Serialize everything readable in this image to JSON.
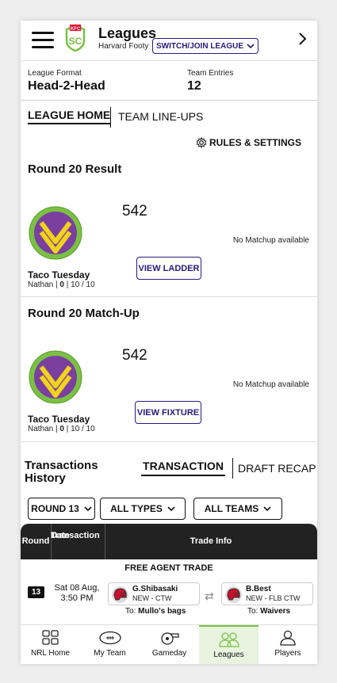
{
  "header": {
    "title": "Leagues",
    "subtitle": "Harvard Footy",
    "switch_label": "SWITCH/JOIN LEAGUE"
  },
  "info": {
    "format_label": "League Format",
    "format_value": "Head-2-Head",
    "entries_label": "Team Entries",
    "entries_value": "12"
  },
  "tabs": {
    "league_home": "LEAGUE HOME",
    "team_lineups": "TEAM LINE-UPS"
  },
  "rules_label": "RULES & SETTINGS",
  "result": {
    "title": "Round 20 Result",
    "score": "542",
    "no_matchup": "No Matchup available",
    "button": "VIEW LADDER",
    "team_name": "Taco Tuesday",
    "owner": "Nathan",
    "owner_points": "0",
    "owner_record": "| 10 / 10"
  },
  "matchup": {
    "title": "Round 20 Match-Up",
    "score": "542",
    "no_matchup": "No Matchup available",
    "button": "VIEW FIXTURE",
    "team_name": "Taco Tuesday",
    "owner": "Nathan",
    "owner_points": "0",
    "owner_record": "| 10 / 10"
  },
  "transactions": {
    "title_line1": "Transactions",
    "title_line2": "History",
    "tab_transaction": "TRANSACTION",
    "tab_draft": "DRAFT RECAP",
    "filter_round": "ROUND 13",
    "filter_types": "ALL TYPES",
    "filter_teams": "ALL TEAMS",
    "col_round": "Round",
    "col_date_1": "Transaction",
    "col_date_2": "Date",
    "col_trade": "Trade Info",
    "row": {
      "trade_type": "FREE AGENT TRADE",
      "round": "13",
      "date_line1": "Sat 08 Aug,",
      "date_line2": "3:50 PM",
      "player_in_name": "G.Shibasaki",
      "player_in_info": "NEW - CTW",
      "player_in_to_prefix": "To:",
      "player_in_to": "Mullo's bags",
      "player_out_name": "B.Best",
      "player_out_info": "NEW - FLB CTW",
      "player_out_to_prefix": "To:",
      "player_out_to": "Waivers"
    }
  },
  "nav": {
    "items": [
      "NRL Home",
      "My Team",
      "Gameday",
      "Leagues",
      "Players"
    ],
    "active": "Leagues"
  },
  "colors": {
    "accent": "#2a1a7a",
    "team_purple": "#7b3fa0",
    "team_green": "#7ac143",
    "team_yellow": "#f2d31b",
    "brand_red": "#e4002b",
    "nav_active": "#7ac143"
  },
  "icons": [
    "hamburger-icon",
    "kfc-sc-logo",
    "chevron-down-icon",
    "chevron-right-icon",
    "gear-icon",
    "helmet-icon",
    "swap-icon",
    "grid-icon",
    "football-icon",
    "whistle-icon",
    "users-icon",
    "person-icon"
  ]
}
